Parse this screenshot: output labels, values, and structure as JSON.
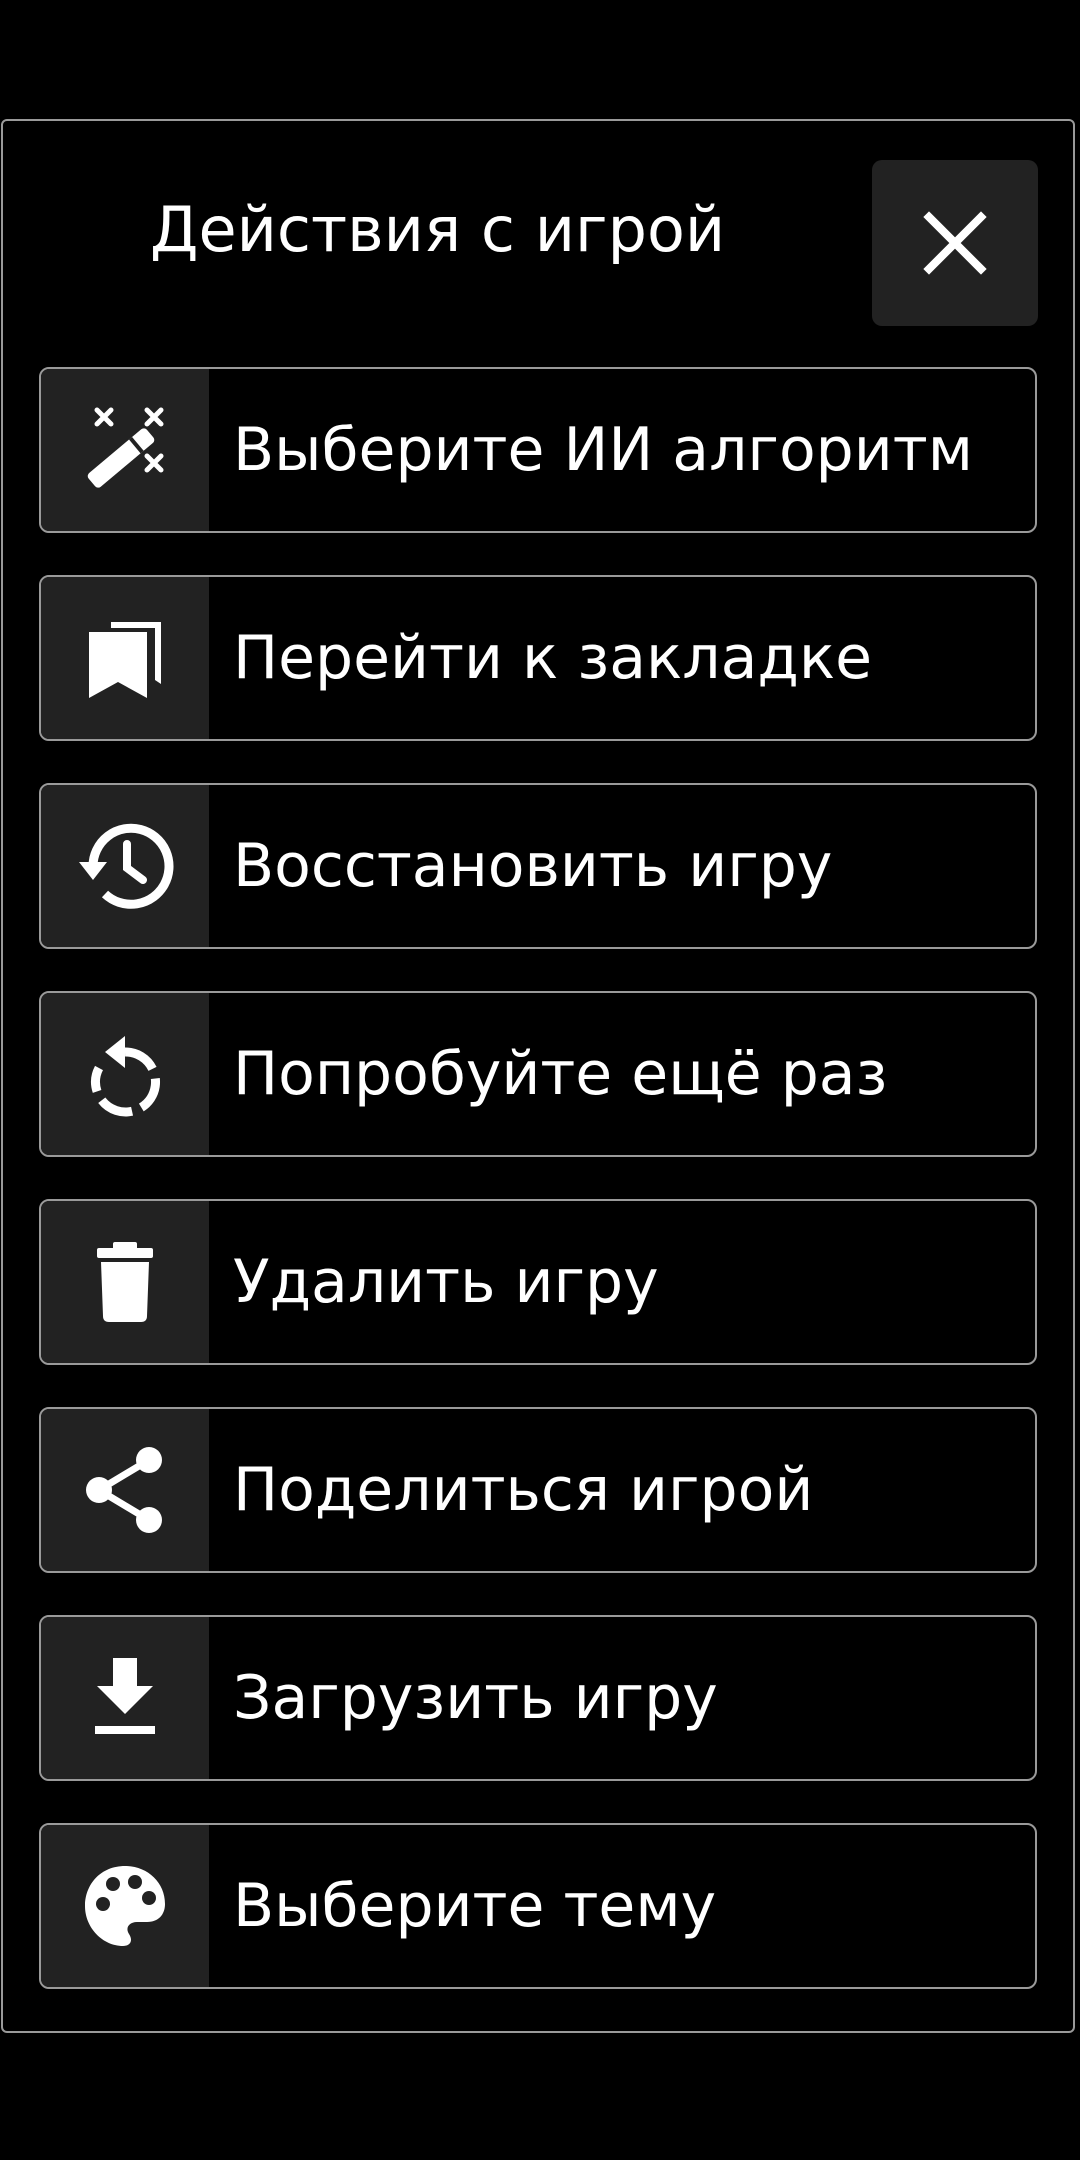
{
  "dialog": {
    "title": "Действия с игрой",
    "close_icon": "close-icon"
  },
  "menu": {
    "items": [
      {
        "label": "Выберите ИИ алгоритм",
        "icon": "magic-wand-icon"
      },
      {
        "label": "Перейти к закладке",
        "icon": "bookmarks-icon"
      },
      {
        "label": "Восстановить игру",
        "icon": "history-icon"
      },
      {
        "label": "Попробуйте ещё раз",
        "icon": "retry-icon"
      },
      {
        "label": "Удалить игру",
        "icon": "trash-icon"
      },
      {
        "label": "Поделиться игрой",
        "icon": "share-icon"
      },
      {
        "label": "Загрузить игру",
        "icon": "download-icon"
      },
      {
        "label": "Выберите тему",
        "icon": "palette-icon"
      }
    ]
  },
  "colors": {
    "background": "#000000",
    "icon_panel": "#222222",
    "border": "#9a9a9a",
    "text": "#ffffff"
  }
}
